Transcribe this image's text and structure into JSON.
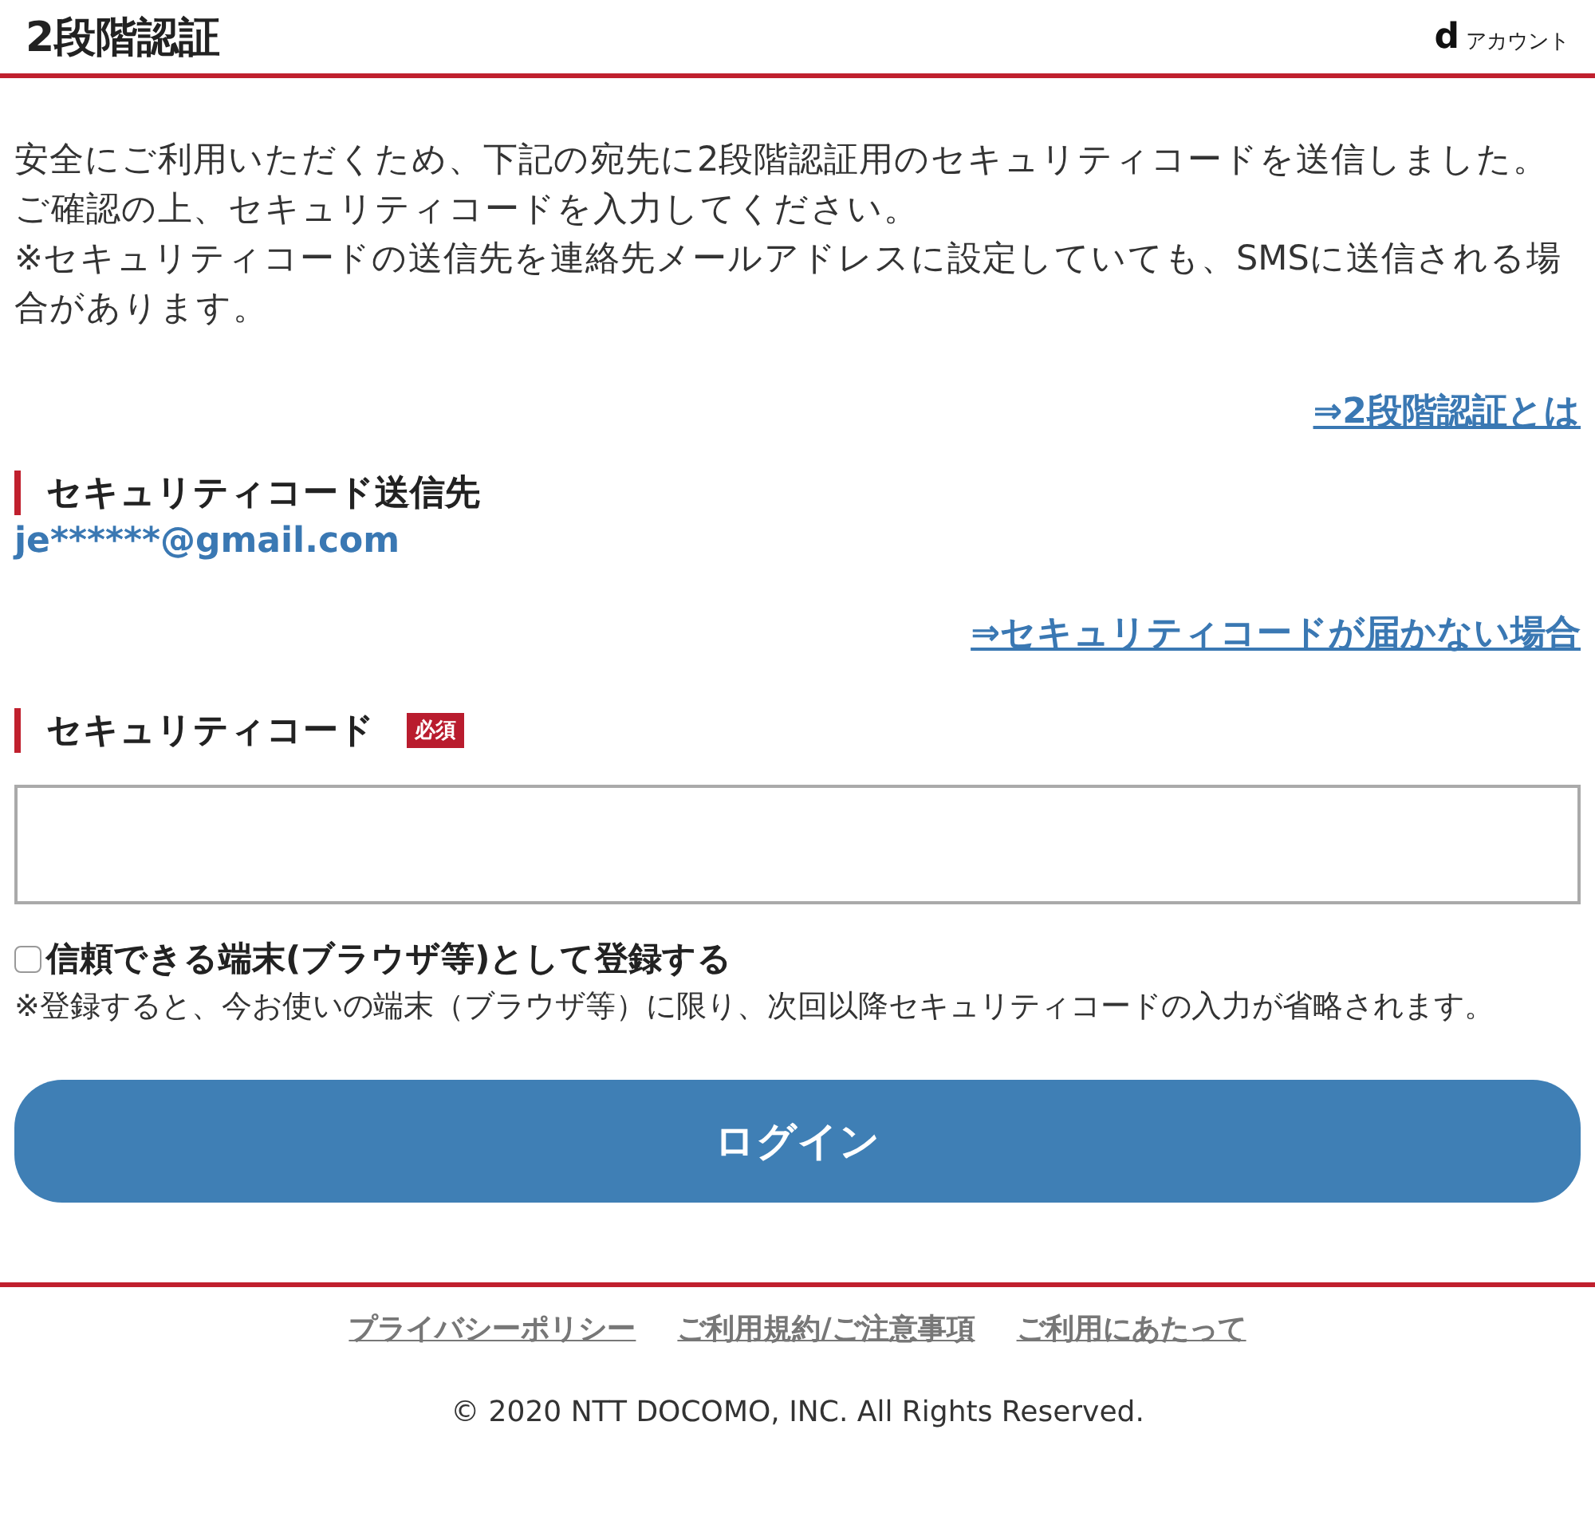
{
  "header": {
    "title": "2段階認証",
    "logo_letter": "d",
    "logo_text": "アカウント"
  },
  "intro": [
    "安全にご利用いただくため、下記の宛先に2段階認証用のセキュリティコードを送信しました。ご確認の上、セキュリティコードを入力してください。",
    "※セキュリティコードの送信先を連絡先メールアドレスに設定していても、SMSに送信される場合があります。"
  ],
  "help_link": "⇒2段階認証とは",
  "destination": {
    "heading": "セキュリティコード送信先",
    "email": "je******@gmail.com"
  },
  "not_received_link": "⇒セキュリティコードが届かない場合",
  "code_field": {
    "heading": "セキュリティコード",
    "badge": "必須"
  },
  "trust_device": {
    "label": "信頼できる端末(ブラウザ等)として登録する",
    "checked": false,
    "note": "※登録すると、今お使いの端末（ブラウザ等）に限り、次回以降セキュリティコードの入力が省略されます。"
  },
  "login_button": "ログイン",
  "footer": {
    "links": [
      "プライバシーポリシー",
      "ご利用規約/ご注意事項",
      "ご利用にあたって"
    ],
    "copyright": "© 2020 NTT DOCOMO, INC. All Rights Reserved."
  }
}
